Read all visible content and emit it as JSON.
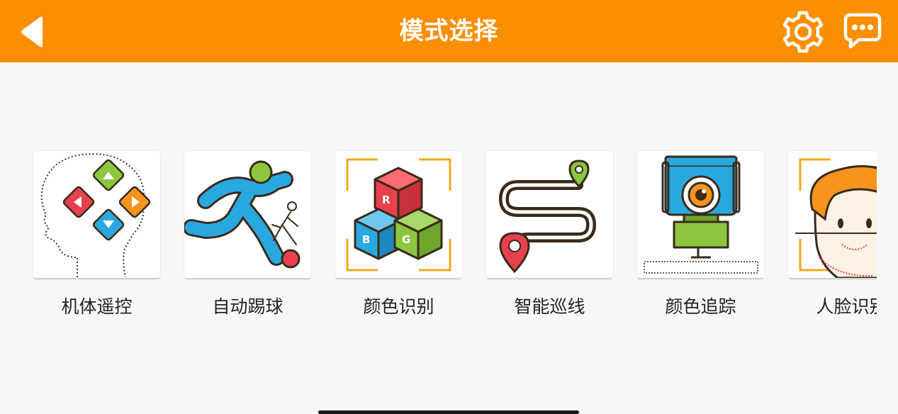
{
  "header": {
    "title": "模式选择",
    "back_icon": "back-arrow-icon",
    "settings_icon": "gear-icon",
    "chat_icon": "chat-bubble-icon",
    "color": "#fb8f00"
  },
  "modes": [
    {
      "label": "机体遥控",
      "icon": "head-dpad-icon"
    },
    {
      "label": "自动踢球",
      "icon": "kick-ball-icon"
    },
    {
      "label": "颜色识别",
      "icon": "rgb-cubes-icon",
      "cube_letters": [
        "R",
        "B",
        "G"
      ]
    },
    {
      "label": "智能巡线",
      "icon": "line-path-icon"
    },
    {
      "label": "颜色追踪",
      "icon": "camera-tracking-icon"
    },
    {
      "label": "人脸识别",
      "icon": "face-recognition-icon"
    }
  ]
}
